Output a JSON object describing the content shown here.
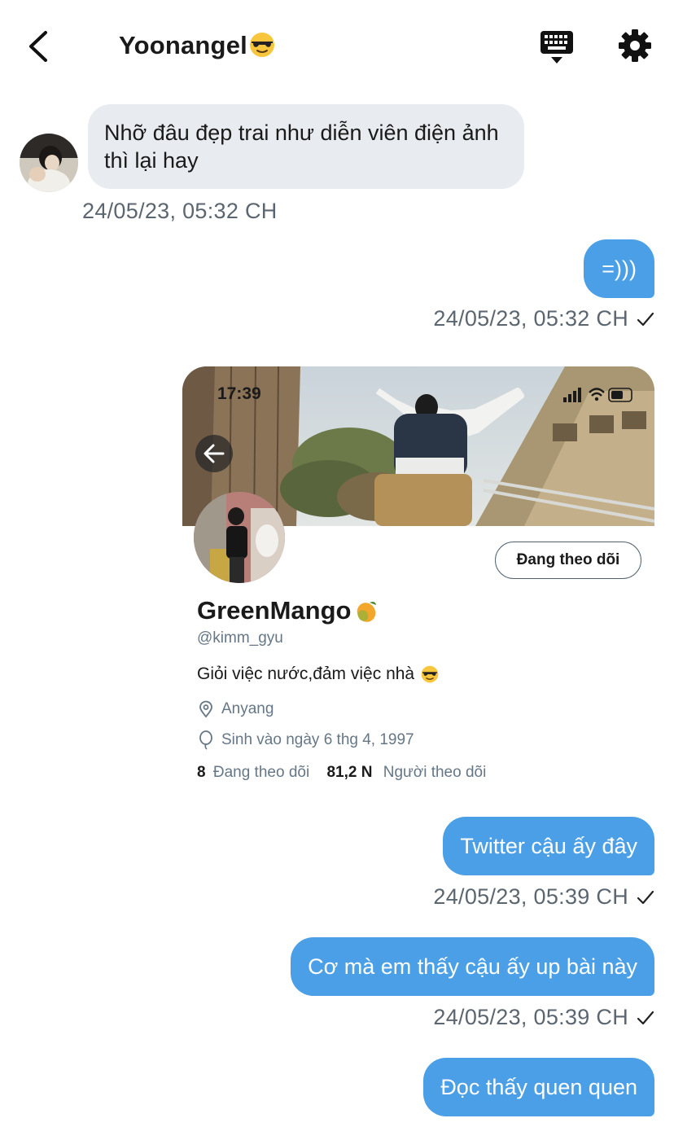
{
  "header": {
    "title": "Yoonangel",
    "title_emoji": "sunglasses-emoji"
  },
  "messages": {
    "m1": {
      "text": "Nhỡ đâu đẹp trai như diễn viên điện ảnh thì lại hay",
      "time": "24/05/23, 05:32 CH"
    },
    "m2": {
      "text": "=)))",
      "time": "24/05/23, 05:32 CH"
    },
    "m3": {
      "time": ""
    },
    "m4": {
      "text": "Twitter cậu ấy đây",
      "time": "24/05/23, 05:39 CH"
    },
    "m5": {
      "text": "Cơ mà em thấy cậu ấy up bài này",
      "time": "24/05/23, 05:39 CH"
    },
    "m6": {
      "text": "Đọc thấy quen quen"
    }
  },
  "profile_card": {
    "status_time": "17:39",
    "follow_label": "Đang theo dõi",
    "name": "GreenMango",
    "name_emoji": "mango-emoji",
    "handle": "@kimm_gyu",
    "bio": "Giỏi việc nước,đảm việc nhà",
    "bio_emoji": "sunglasses-emoji",
    "location": "Anyang",
    "birthday": "Sinh vào ngày 6 thg 4, 1997",
    "following_count": "8",
    "following_label": "Đang theo dõi",
    "followers_count": "81,2 N",
    "followers_label": "Người theo dõi"
  },
  "colors": {
    "outgoing_bubble": "#4a9fe6",
    "incoming_bubble": "#e8ebef",
    "timestamp": "#5b6670"
  }
}
